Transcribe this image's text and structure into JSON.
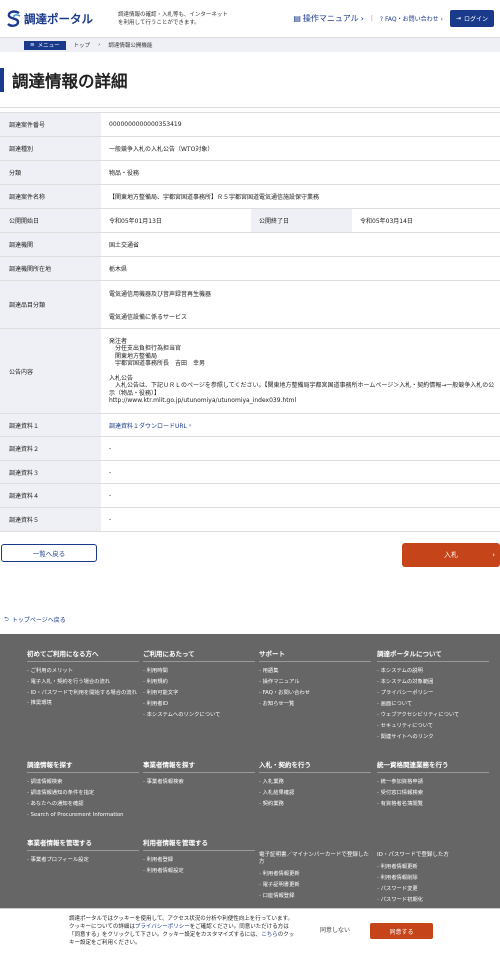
{
  "header": {
    "logo_text": "調達ポータル",
    "tagline": "調達情報の確認・入札等も、インターネットを利用して行うことができます。",
    "manual_label": "操作マニュアル",
    "faq_label": "FAQ・お問い合わせ",
    "login_label": "ログイン"
  },
  "breadcrumb": {
    "menu_label": "メニュー",
    "top": "トップ",
    "current": "調達情報公開機能"
  },
  "page_title": "調達情報の詳細",
  "details": {
    "case_no_label": "調達案件番号",
    "case_no": "0000000000000353419",
    "type_label": "調達種別",
    "type": "一般競争入札の入札公告（WTO対象）",
    "category_label": "分類",
    "category": "物品・役務",
    "name_label": "調達案件名称",
    "name": "【関東地方整備局、宇都宮国道事務所】Ｒ５宇都宮国道電気通信施設保守業務",
    "start_label": "公開開始日",
    "start": "令和05年01月13日",
    "end_label": "公開終了日",
    "end": "令和05年03月14日",
    "org_label": "調達機関",
    "org": "国土交通省",
    "location_label": "調達機関所在地",
    "location": "栃木県",
    "items_label": "調達品目分類",
    "item1": "電気通信用機器及び音声録音再生機器",
    "item2": "電気通信設備に係るサービス",
    "notice_label": "公告内容",
    "notice_block1": "発注者\n　分任支出負担行為担当官\n　関東地方整備局\n　宇都宮国道事務所長　吉田　幸男",
    "notice_block2": "入札公告\n　入札公告は、下記ＵＲＬのページを参照してください。【関東地方整備局宇都宮国道事務所ホームページ＞入札・契約情報→一般競争入札の公示（物品・役務）】\nhttp://www.ktr.mlit.go.jp/utunomiya/utunomiya_index039.html",
    "doc1_label": "調達資料１",
    "doc1": "調達資料１ダウンロードURL",
    "doc2_label": "調達資料２",
    "doc2": "-",
    "doc3_label": "調達資料３",
    "doc3": "-",
    "doc4_label": "調達資料４",
    "doc4": "-",
    "doc5_label": "調達資料５",
    "doc5": "-"
  },
  "buttons": {
    "back": "一覧へ戻る",
    "bid": "入札"
  },
  "toplink": "トップページへ戻る",
  "footer": {
    "col1_title": "初めてご利用になる方へ",
    "col1_items": [
      "ご利用のメリット",
      "電子入札・契約を行う場合の流れ",
      "ID・パスワードで利用を開始する場合の流れ",
      "推奨環境"
    ],
    "col2_title": "ご利用にあたって",
    "col2_items": [
      "利用時間",
      "利用規約",
      "利用可能文字",
      "利用者ID",
      "本システムへのリンクについて"
    ],
    "col3_title": "サポート",
    "col3_items": [
      "用語集",
      "操作マニュアル",
      "FAQ・お問い合わせ",
      "お知らせ一覧"
    ],
    "col4_title": "調達ポータルについて",
    "col4_items": [
      "本システムの説明",
      "本システムの対象範囲",
      "プライバシーポリシー",
      "画面について",
      "ウェブアクセシビリティについて",
      "セキュリティについて",
      "関連サイトへのリンク"
    ],
    "row2_col1_title": "調達情報を探す",
    "row2_col1_items": [
      "調達情報検索",
      "調達情報通知の条件を指定",
      "あなたへの通知を確認",
      "Search of Procurement Information"
    ],
    "row2_col2_title": "事業者情報を探す",
    "row2_col2_items": [
      "事業者情報検索"
    ],
    "row2_col3_title": "入札・契約を行う",
    "row2_col3_items": [
      "入札業務",
      "入札結果確認",
      "契約業務"
    ],
    "row2_col4_title": "統一資格関連業務を行う",
    "row2_col4_items": [
      "統一参加資格申請",
      "受付窓口情報検索",
      "有資格者名簿閲覧"
    ],
    "row3_col1_title": "事業者情報を管理する",
    "row3_col1_items": [
      "事業者プロフィール設定"
    ],
    "row3_col2_title": "利用者情報を管理する",
    "row3_col2_items": [
      "利用者登録",
      "利用者情報設定"
    ],
    "row3_col3_sub": "電子証明書／マイナンバーカードで登録した方",
    "row3_col3_items": [
      "利用者情報更新",
      "電子証明書更新",
      "口座情報登録"
    ],
    "row3_col4_sub": "ID・パスワードで登録した方",
    "row3_col4_items": [
      "利用者情報更新",
      "利用者情報削除",
      "パスワード変更",
      "パスワード初期化"
    ]
  },
  "cookie": {
    "text1": "調達ポータルではクッキーを使用して、アクセス状況の分析や利便性向上を行っています。クッキーについての詳細は",
    "policy_link": "プライバシーポリシー",
    "text2": "をご確認ください。同意いただける方は「同意する」をクリックして下さい。クッキー設定をカスタマイズするには、",
    "here_link": "こちら",
    "text3": "のクッキー設定をご利用ください。",
    "decline": "同意しない",
    "agree": "同意する"
  }
}
